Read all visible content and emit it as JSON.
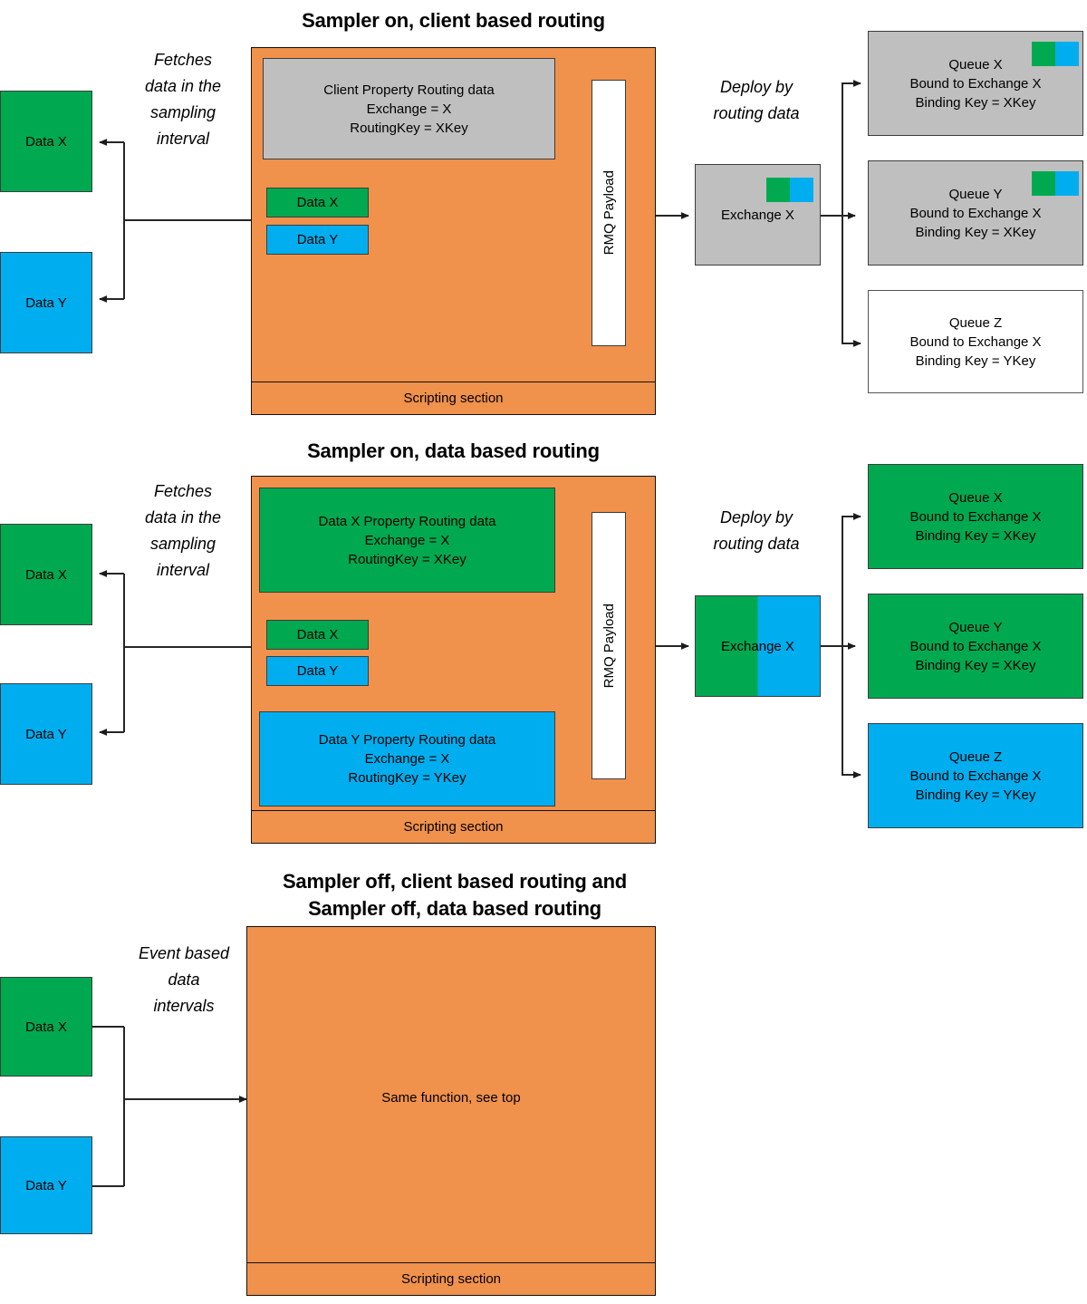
{
  "colors": {
    "orange": "#F0914C",
    "green": "#00A94F",
    "blue": "#00AEEF",
    "grey": "#BFBFBF",
    "white": "#FFFFFF",
    "line": "#262626"
  },
  "sections": [
    {
      "id": "sampler-on-client-based-routing",
      "title": "Sampler on, client based routing",
      "left_note": "Fetches\ndata in the\nsampling\ninterval",
      "mid_note": "Deploy by\nrouting data",
      "source_boxes": [
        {
          "label": "Data X",
          "color": "green"
        },
        {
          "label": "Data Y",
          "color": "blue"
        }
      ],
      "routing_block": {
        "line1": "Client Property Routing data",
        "line2": "Exchange = X",
        "line3": "RoutingKey = XKey",
        "color": "grey"
      },
      "inner_data_boxes": [
        {
          "label": "Data X",
          "color": "green"
        },
        {
          "label": "Data Y",
          "color": "blue"
        }
      ],
      "payload_label": "RMQ Payload",
      "scripting_label": "Scripting section",
      "exchange": {
        "label": "Exchange X",
        "color": "grey",
        "swatch": [
          "green",
          "blue"
        ]
      },
      "queues": [
        {
          "name": "Queue X",
          "bound": "Bound to Exchange X",
          "key": "Binding Key = XKey",
          "color": "grey",
          "swatch": [
            "green",
            "blue"
          ]
        },
        {
          "name": "Queue Y",
          "bound": "Bound to Exchange X",
          "key": "Binding Key = XKey",
          "color": "grey",
          "swatch": [
            "green",
            "blue"
          ]
        },
        {
          "name": "Queue Z",
          "bound": "Bound to Exchange X",
          "key": "Binding Key = YKey",
          "color": "white",
          "swatch": []
        }
      ]
    },
    {
      "id": "sampler-on-data-based-routing",
      "title": "Sampler on, data based routing",
      "left_note": "Fetches\ndata in the\nsampling\ninterval",
      "mid_note": "Deploy by\nrouting data",
      "source_boxes": [
        {
          "label": "Data X",
          "color": "green"
        },
        {
          "label": "Data Y",
          "color": "blue"
        }
      ],
      "routing_block_x": {
        "line1": "Data X Property Routing data",
        "line2": "Exchange = X",
        "line3": "RoutingKey = XKey",
        "color": "green"
      },
      "routing_block_y": {
        "line1": "Data Y Property Routing data",
        "line2": "Exchange = X",
        "line3": "RoutingKey = YKey",
        "color": "blue"
      },
      "inner_data_boxes": [
        {
          "label": "Data X",
          "color": "green"
        },
        {
          "label": "Data Y",
          "color": "blue"
        }
      ],
      "payload_label": "RMQ Payload",
      "scripting_label": "Scripting section",
      "exchange": {
        "label": "Exchange X",
        "color": "split",
        "swatch": [
          "green",
          "blue"
        ]
      },
      "queues": [
        {
          "name": "Queue X",
          "bound": "Bound to Exchange X",
          "key": "Binding Key = XKey",
          "color": "green",
          "swatch": []
        },
        {
          "name": "Queue Y",
          "bound": "Bound to Exchange X",
          "key": "Binding Key = XKey",
          "color": "green",
          "swatch": []
        },
        {
          "name": "Queue Z",
          "bound": "Bound to Exchange X",
          "key": "Binding Key = YKey",
          "color": "blue",
          "swatch": []
        }
      ]
    },
    {
      "id": "sampler-off",
      "title_line1": "Sampler off, client based routing and",
      "title_line2": "Sampler off, data based routing",
      "left_note": "Event based\ndata\nintervals",
      "source_boxes": [
        {
          "label": "Data X",
          "color": "green"
        },
        {
          "label": "Data Y",
          "color": "blue"
        }
      ],
      "body_label": "Same function, see top",
      "scripting_label": "Scripting section"
    }
  ]
}
